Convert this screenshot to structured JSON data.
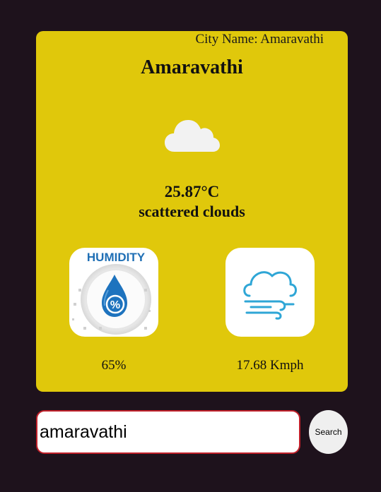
{
  "card": {
    "city_label": "City Name: Amaravathi",
    "city_title": "Amaravathi",
    "weather_icon": "cloud-icon",
    "temperature": "25.87°C",
    "description": "scattered clouds",
    "background_color": "#e0c80b"
  },
  "humidity": {
    "icon": "humidity-icon",
    "icon_text": "HUMIDITY",
    "icon_symbol": "%",
    "value": "65%"
  },
  "wind": {
    "icon": "wind-icon",
    "value": "17.68 Kmph"
  },
  "search": {
    "value": "amaravathi",
    "button_label": "Search",
    "border_color": "#c0202a"
  }
}
